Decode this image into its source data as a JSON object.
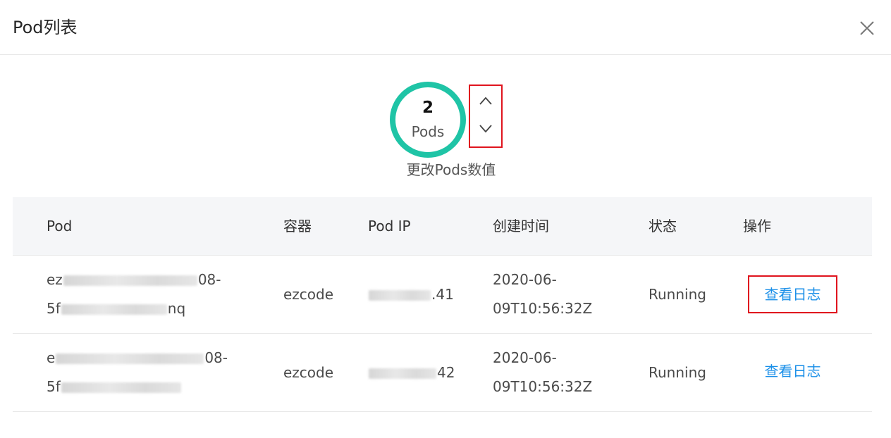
{
  "modal": {
    "title": "Pod列表"
  },
  "pods": {
    "count": "2",
    "unit": "Pods",
    "caption": "更改Pods数值"
  },
  "table": {
    "headers": [
      "Pod",
      "容器",
      "Pod IP",
      "创建时间",
      "状态",
      "操作"
    ],
    "rows": [
      {
        "pod_line1_prefix": "ez",
        "pod_line1_suffix": "08-",
        "pod_line2_prefix": "5f",
        "pod_line2_suffix": "nq",
        "container": "ezcode",
        "ip_suffix": ".41",
        "created_line1": "2020-06-",
        "created_line2": "09T10:56:32Z",
        "status": "Running",
        "action": "查看日志"
      },
      {
        "pod_line1_prefix": "e",
        "pod_line1_suffix": "08-",
        "pod_line2_prefix": "5f",
        "pod_line2_suffix": "",
        "container": "ezcode",
        "ip_suffix": "42",
        "created_line1": "2020-06-",
        "created_line2": "09T10:56:32Z",
        "status": "Running",
        "action": "查看日志"
      }
    ]
  },
  "icons": {
    "close": "close-icon",
    "increment": "chevron-up-icon",
    "decrement": "chevron-down-icon"
  },
  "colors": {
    "ring": "#1fc4a6",
    "link": "#1a8fe8",
    "highlight": "#e0141e",
    "header_bg": "#f5f6f8"
  }
}
